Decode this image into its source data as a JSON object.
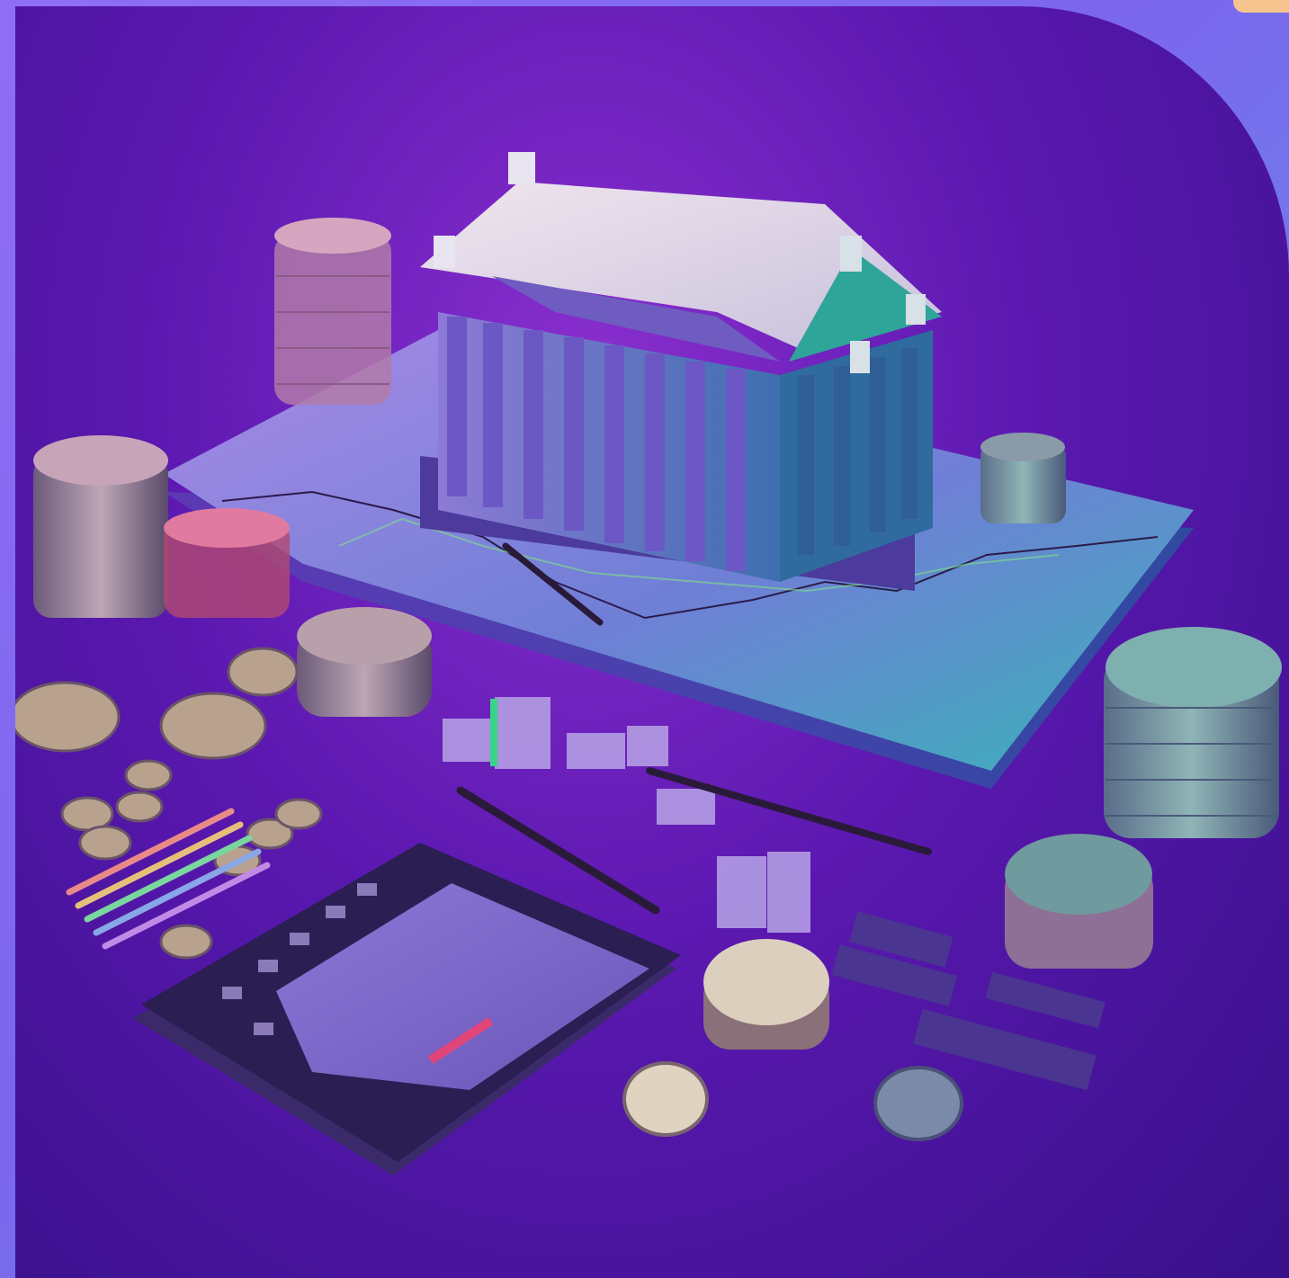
{
  "image": {
    "subject": "isometric-3d-finance-scene",
    "palette": {
      "frame": "#8d6cf0",
      "corner_tab": "#f6c48e",
      "background_light": "#8a2fcf",
      "background_dark": "#37108a",
      "bank_roof": "#d9d2e6",
      "bank_body": "#7a68c9",
      "platform_teal": "#3fa8b8",
      "coin_gold": "#c9b79a",
      "chart_pink": "#e0457a"
    }
  }
}
